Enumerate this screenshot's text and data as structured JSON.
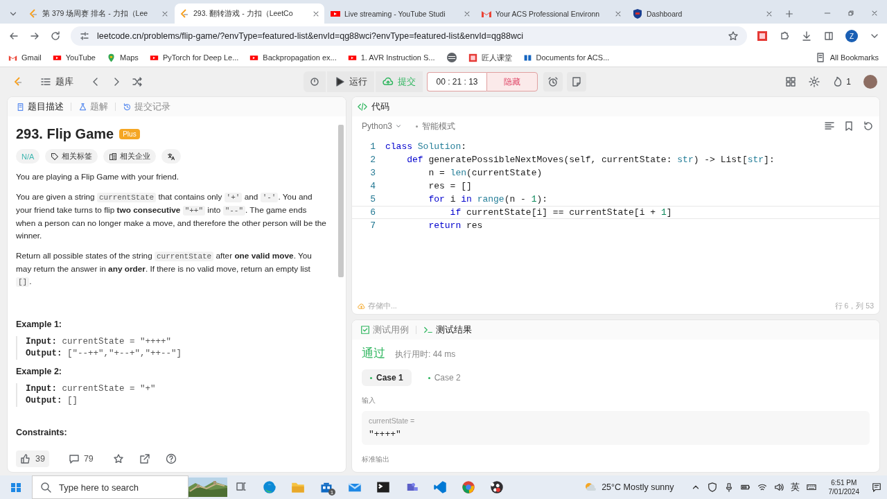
{
  "browser": {
    "tabs": [
      {
        "title": "第 379 场周赛 排名 - 力扣（Lee",
        "selected": false
      },
      {
        "title": "293. 翻转游戏 - 力扣（LeetCo",
        "selected": true
      },
      {
        "title": "Live streaming - YouTube Studi",
        "selected": false
      },
      {
        "title": "Your ACS Professional Environn",
        "selected": false
      },
      {
        "title": "Dashboard",
        "selected": false
      }
    ],
    "address": "leetcode.cn/problems/flip-game/?envType=featured-list&envId=qg88wci?envType=featured-list&envId=qg88wci",
    "profile": "Z",
    "bookmarks": [
      "Gmail",
      "YouTube",
      "Maps",
      "PyTorch for Deep Le...",
      "Backpropagation ex...",
      "1. AVR Instruction S...",
      "匠人课堂",
      "Documents for ACS..."
    ],
    "all_bookmarks": "All Bookmarks"
  },
  "toolbar": {
    "problem_list": "题库",
    "run": "运行",
    "submit": "提交",
    "timer": "00 : 21 : 13",
    "hide": "隐藏",
    "streak": "1"
  },
  "description": {
    "tabs": [
      {
        "label": "题目描述",
        "selected": true
      },
      {
        "label": "题解",
        "selected": false
      },
      {
        "label": "提交记录",
        "selected": false
      }
    ],
    "title": "293. Flip Game",
    "badge": "Plus",
    "difficulty": "N/A",
    "tags": [
      "相关标签",
      "相关企业"
    ],
    "paragraphs": [
      [
        {
          "kind": "text",
          "text": "You are playing a Flip Game with your friend."
        }
      ],
      [
        {
          "kind": "text",
          "text": "You are given a string "
        },
        {
          "kind": "code",
          "text": "currentState"
        },
        {
          "kind": "text",
          "text": " that contains only "
        },
        {
          "kind": "code",
          "text": "'+'"
        },
        {
          "kind": "text",
          "text": " and "
        },
        {
          "kind": "code",
          "text": "'-'"
        },
        {
          "kind": "text",
          "text": ". You and your friend take turns to flip "
        },
        {
          "kind": "bold",
          "text": "two consecutive "
        },
        {
          "kind": "code",
          "text": "\"++\""
        },
        {
          "kind": "text",
          "text": " into "
        },
        {
          "kind": "code",
          "text": "\"--\""
        },
        {
          "kind": "text",
          "text": ". The game ends when a person can no longer make a move, and therefore the other person will be the winner."
        }
      ],
      [
        {
          "kind": "text",
          "text": "Return all possible states of the string "
        },
        {
          "kind": "code",
          "text": "currentState"
        },
        {
          "kind": "text",
          "text": " after "
        },
        {
          "kind": "bold",
          "text": "one valid move"
        },
        {
          "kind": "text",
          "text": ". You may return the answer in "
        },
        {
          "kind": "bold",
          "text": "any order"
        },
        {
          "kind": "text",
          "text": ". If there is no valid move, return an empty list "
        },
        {
          "kind": "code",
          "text": "[]"
        },
        {
          "kind": "text",
          "text": "."
        }
      ]
    ],
    "examples": [
      {
        "title": "Example 1:",
        "lines": [
          {
            "label": "Input:",
            "value": "currentState = \"++++\""
          },
          {
            "label": "Output:",
            "value": "[\"--++\",\"+--+\",\"++--\"]"
          }
        ]
      },
      {
        "title": "Example 2:",
        "lines": [
          {
            "label": "Input:",
            "value": "currentState = \"+\""
          },
          {
            "label": "Output:",
            "value": "[]"
          }
        ]
      }
    ],
    "constraints": "Constraints:",
    "likes": "39",
    "comments": "79"
  },
  "code": {
    "title": "代码",
    "language": "Python3",
    "mode": "智能模式",
    "lines": [
      {
        "number": "1",
        "current": false,
        "tokens": [
          {
            "kind": "kw",
            "text": "class "
          },
          {
            "kind": "type",
            "text": "Solution"
          },
          {
            "kind": "plain",
            "text": ":"
          }
        ]
      },
      {
        "number": "2",
        "current": false,
        "tokens": [
          {
            "kind": "kw",
            "text": "    def"
          },
          {
            "kind": "plain",
            "text": " generatePossibleNextMoves(self, currentState: "
          },
          {
            "kind": "type",
            "text": "str"
          },
          {
            "kind": "plain",
            "text": ") -> List["
          },
          {
            "kind": "type",
            "text": "str"
          },
          {
            "kind": "plain",
            "text": "]:"
          }
        ]
      },
      {
        "number": "3",
        "current": false,
        "tokens": [
          {
            "kind": "plain",
            "text": "        n = "
          },
          {
            "kind": "builtin",
            "text": "len"
          },
          {
            "kind": "plain",
            "text": "(currentState)"
          }
        ]
      },
      {
        "number": "4",
        "current": false,
        "tokens": [
          {
            "kind": "plain",
            "text": "        res = []"
          }
        ]
      },
      {
        "number": "5",
        "current": false,
        "tokens": [
          {
            "kind": "kw",
            "text": "        for"
          },
          {
            "kind": "plain",
            "text": " i "
          },
          {
            "kind": "kw",
            "text": "in "
          },
          {
            "kind": "builtin",
            "text": "range"
          },
          {
            "kind": "plain",
            "text": "(n - "
          },
          {
            "kind": "num",
            "text": "1"
          },
          {
            "kind": "plain",
            "text": "):"
          }
        ]
      },
      {
        "number": "6",
        "current": true,
        "tokens": [
          {
            "kind": "kw",
            "text": "            if"
          },
          {
            "kind": "plain",
            "text": " currentState[i] == currentState[i + "
          },
          {
            "kind": "num",
            "text": "1"
          },
          {
            "kind": "plain",
            "text": "]"
          }
        ]
      },
      {
        "number": "7",
        "current": false,
        "tokens": [
          {
            "kind": "kw",
            "text": "        return"
          },
          {
            "kind": "plain",
            "text": " res"
          }
        ]
      }
    ],
    "status": "存储中...",
    "position": "行 6，列 53"
  },
  "results": {
    "tabs": [
      {
        "label": "测试用例",
        "selected": false
      },
      {
        "label": "测试结果",
        "selected": true
      }
    ],
    "verdict": "通过",
    "runtime": "执行用时: 44 ms",
    "cases": [
      {
        "label": "Case 1",
        "selected": true
      },
      {
        "label": "Case 2",
        "selected": false
      }
    ],
    "input_label": "输入",
    "inputs": [
      {
        "name": "currentState =",
        "value": "\"++++\""
      }
    ],
    "output_label": "标准输出"
  },
  "taskbar": {
    "search_placeholder": "Type here to search",
    "store_badge": "1",
    "weather": "25°C Mostly sunny",
    "language": "英",
    "time": "6:51 PM",
    "date": "7/01/2024"
  }
}
